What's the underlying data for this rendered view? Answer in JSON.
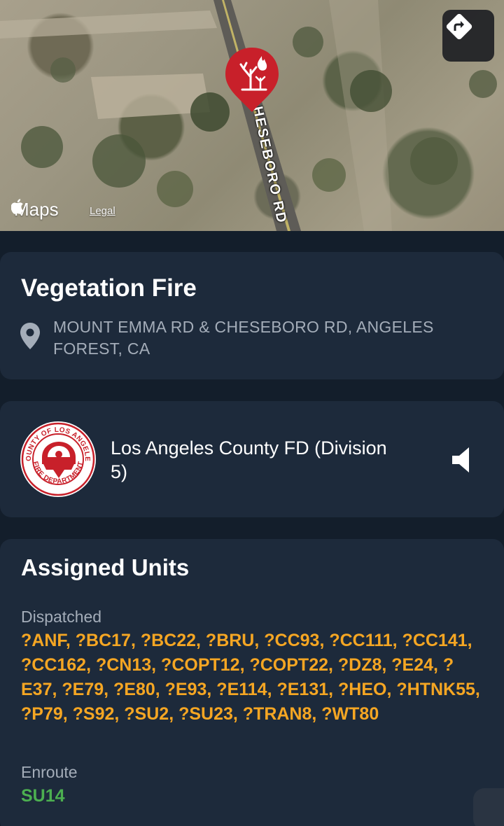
{
  "map": {
    "logo": "Maps",
    "legal": "Legal",
    "road_label": "HESEBORO RD",
    "pin_icon": "vegetation-fire-icon",
    "directions_icon": "directions-arrow-icon"
  },
  "incident": {
    "title": "Vegetation Fire",
    "address": "MOUNT EMMA RD & CHESEBORO RD, ANGELES FOREST, CA"
  },
  "agency": {
    "name": "Los Angeles County FD (Division 5)",
    "seal_text_top": "COUNTY OF LOS ANGELES",
    "seal_text_bottom": "FIRE DEPARTMENT",
    "audio_icon": "speaker-icon"
  },
  "units": {
    "title": "Assigned Units",
    "dispatched_label": "Dispatched",
    "dispatched": "?ANF, ?BC17, ?BC22, ?BRU, ?CC93, ?CC111, ?CC141, ?CC162, ?CN13, ?COPT12, ?COPT22, ?DZ8, ?E24, ?E37, ?E79, ?E80, ?E93, ?E114, ?E131, ?HEO, ?HTNK55, ?P79, ?S92, ?SU2, ?SU23, ?TRAN8, ?WT80",
    "enroute_label": "Enroute",
    "enroute": "SU14"
  },
  "colors": {
    "background": "#131e2b",
    "card": "#1d2a3b",
    "dispatched": "#f5a623",
    "enroute": "#4caf50",
    "pin": "#c8202a"
  }
}
